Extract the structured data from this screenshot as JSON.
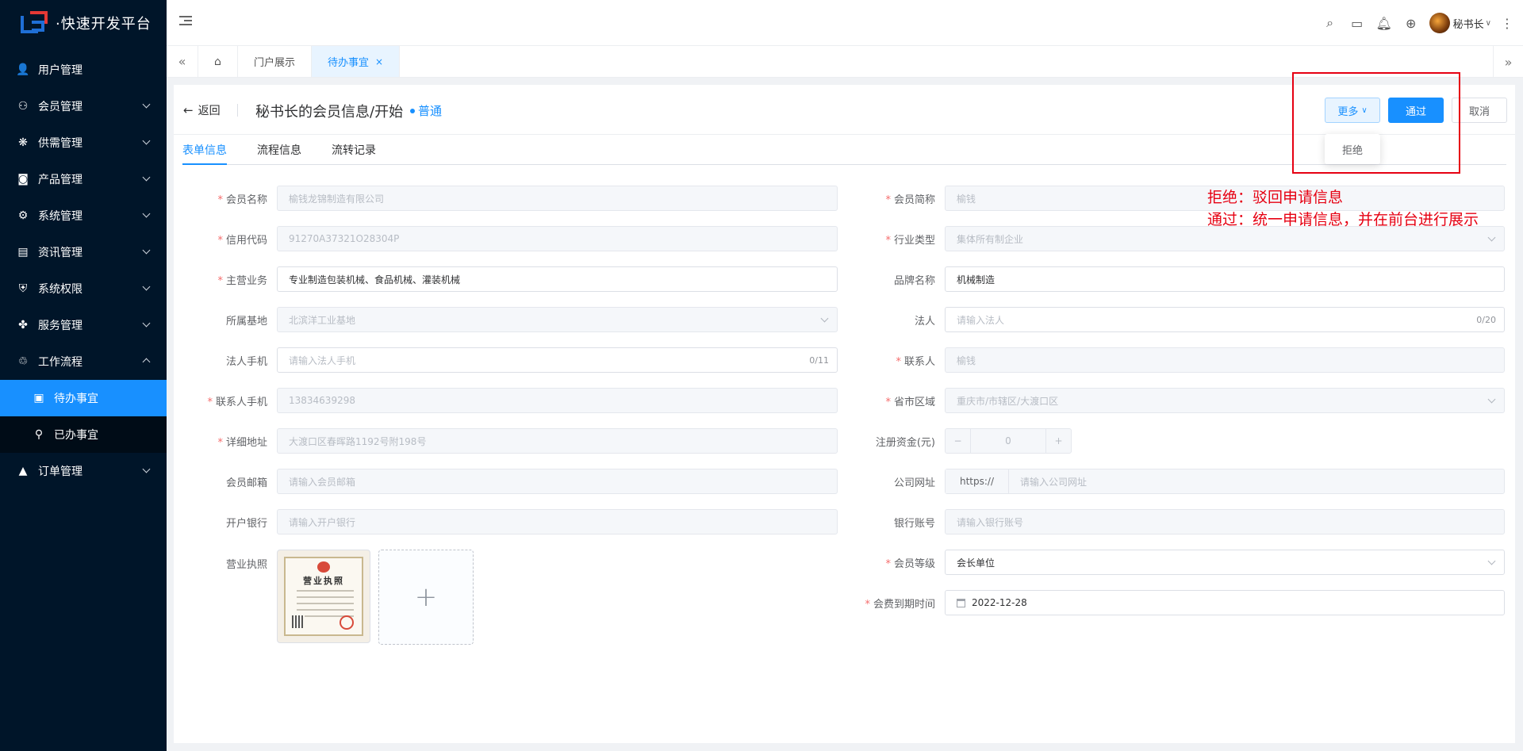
{
  "app": {
    "logo_text": "·快速开发平台"
  },
  "sidebar": {
    "items": [
      {
        "label": "用户管理"
      },
      {
        "label": "会员管理"
      },
      {
        "label": "供需管理"
      },
      {
        "label": "产品管理"
      },
      {
        "label": "系统管理"
      },
      {
        "label": "资讯管理"
      },
      {
        "label": "系统权限"
      },
      {
        "label": "服务管理"
      },
      {
        "label": "工作流程"
      },
      {
        "label": "订单管理"
      }
    ],
    "sub_items": [
      {
        "label": "待办事宜",
        "active": true
      },
      {
        "label": "已办事宜"
      }
    ]
  },
  "header": {
    "user_name": "秘书长"
  },
  "tabs": [
    {
      "label": "门户展示"
    },
    {
      "label": "待办事宜",
      "active": true,
      "close": "×"
    }
  ],
  "page": {
    "back_label": "返回",
    "title": "秘书长的会员信息/开始",
    "status": "普通",
    "buttons": {
      "more": "更多",
      "pass": "通过",
      "cancel": "取消"
    },
    "dropdown": {
      "reject": "拒绝"
    },
    "annotation": {
      "line1": "拒绝：驳回申请信息",
      "line2": "通过：统一申请信息，并在前台进行展示"
    },
    "sub_tabs": [
      "表单信息",
      "流程信息",
      "流转记录"
    ]
  },
  "form": {
    "member_name": {
      "label": "会员名称",
      "value": "榆钱龙锦制造有限公司"
    },
    "short_name": {
      "label": "会员简称",
      "value": "榆钱"
    },
    "credit_code": {
      "label": "信用代码",
      "value": "91270A37321O28304P"
    },
    "industry": {
      "label": "行业类型",
      "value": "集体所有制企业"
    },
    "main_business": {
      "label": "主营业务",
      "value": "专业制造包装机械、食品机械、灌装机械"
    },
    "brand": {
      "label": "品牌名称",
      "value": "机械制造"
    },
    "base": {
      "label": "所属基地",
      "value": "北滨洋工业基地"
    },
    "legal": {
      "label": "法人",
      "placeholder": "请输入法人",
      "count": "0/20"
    },
    "legal_phone": {
      "label": "法人手机",
      "placeholder": "请输入法人手机",
      "count": "0/11"
    },
    "contact": {
      "label": "联系人",
      "value": "榆钱"
    },
    "contact_phone": {
      "label": "联系人手机",
      "value": "13834639298"
    },
    "region": {
      "label": "省市区域",
      "value": "重庆市/市辖区/大渡口区"
    },
    "address": {
      "label": "详细地址",
      "value": "大渡口区春晖路1192号附198号"
    },
    "capital": {
      "label": "注册资金(元)",
      "value": "0",
      "minus": "−",
      "plus": "+"
    },
    "email": {
      "label": "会员邮箱",
      "placeholder": "请输入会员邮箱"
    },
    "website": {
      "label": "公司网址",
      "prefix": "https://",
      "placeholder": "请输入公司网址"
    },
    "bank": {
      "label": "开户银行",
      "placeholder": "请输入开户银行"
    },
    "account": {
      "label": "银行账号",
      "placeholder": "请输入银行账号"
    },
    "license": {
      "label": "营业执照",
      "cert_title": "营业执照",
      "add": "+"
    },
    "level": {
      "label": "会员等级",
      "value": "会长单位"
    },
    "expire": {
      "label": "会费到期时间",
      "value": "2022-12-28"
    }
  }
}
